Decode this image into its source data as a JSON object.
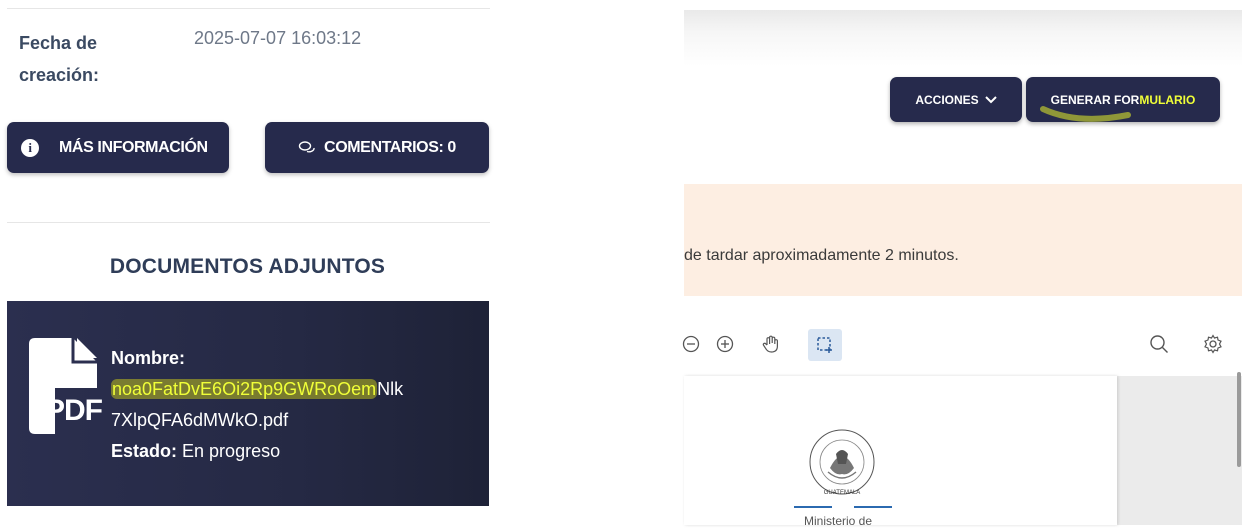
{
  "left_panel": {
    "fecha_label": "Fecha de creación:",
    "fecha_value": "2025-07-07 16:03:12",
    "info_button": "MÁS INFORMACIÓN",
    "comments_button": "COMENTARIOS: 0",
    "docs_heading": "DOCUMENTOS ADJUNTOS",
    "doc": {
      "name_label": "Nombre:",
      "name_part1": "noa0FatDvE6Oi2Rp9GWRoOem",
      "name_part2": "Nlk",
      "name_line2": "7XlpQFA6dMWkO.pdf",
      "status_label": "Estado:",
      "status_value": "En progreso",
      "icon_label": "PDF"
    }
  },
  "right_panel": {
    "acciones_button": "ACCIONES",
    "generar_button_a": "GENERAR FOR",
    "generar_button_b": "MULARIO",
    "alert_text": "de tardar aproximadamente 2 minutos.",
    "page_text": "Ministerio de",
    "seal_text": "GUATEMALA"
  },
  "colors": {
    "accent_dark": "#262a4c",
    "highlight": "#f0ff38",
    "alert_bg": "#fdeee2"
  }
}
